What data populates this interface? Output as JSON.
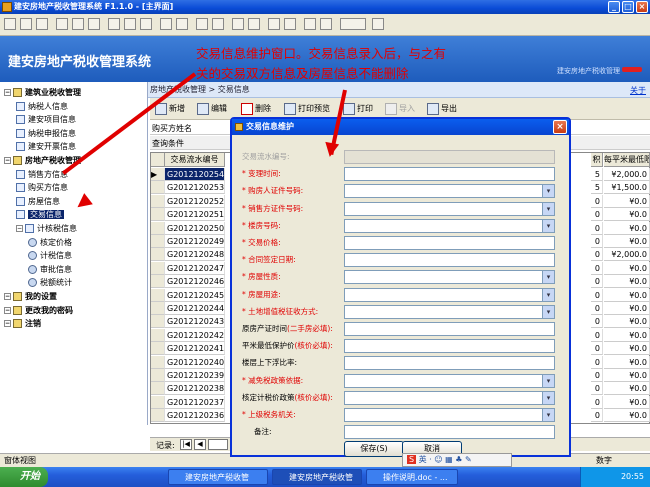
{
  "window": {
    "title": "建安房地产税收管理系统 F1.1.0 - [主界面]",
    "min": "_",
    "max": "□",
    "close": "×"
  },
  "banner": {
    "app_title": "建安房地产税收管理系统",
    "user_info": "建安房地产税收管理",
    "help_link": "关于"
  },
  "annotation": {
    "line1": "交易信息维护窗口。交易信息录入后，与之有",
    "line2": "关的交易双方信息及房屋信息不能删除"
  },
  "tree": {
    "items": [
      {
        "label": "建筑业税收管理",
        "bold": true,
        "level": 0
      },
      {
        "label": "纳税人信息",
        "level": 1
      },
      {
        "label": "建安项目信息",
        "level": 1
      },
      {
        "label": "纳税申报信息",
        "level": 1
      },
      {
        "label": "建安开票信息",
        "level": 1
      },
      {
        "label": "房地产税收管理",
        "bold": true,
        "level": 0
      },
      {
        "label": "销售方信息",
        "level": 1
      },
      {
        "label": "购买方信息",
        "level": 1
      },
      {
        "label": "房屋信息",
        "level": 1
      },
      {
        "label": "交易信息",
        "level": 1,
        "selected": true
      },
      {
        "label": "计核税信息",
        "level": 1
      },
      {
        "label": "核定价格",
        "level": 2
      },
      {
        "label": "计税信息",
        "level": 2
      },
      {
        "label": "审批信息",
        "level": 2
      },
      {
        "label": "税额统计",
        "level": 2
      },
      {
        "label": "我的设置",
        "bold": true,
        "level": 0
      },
      {
        "label": "更改我的密码",
        "bold": true,
        "level": 0
      },
      {
        "label": "注销",
        "bold": true,
        "level": 0
      }
    ]
  },
  "breadcrumb": "房地产税收管理 > 交易信息",
  "subtoolbar": {
    "new": "新增",
    "edit": "编辑",
    "delete": "删除",
    "print_preview": "打印预览",
    "print": "打印",
    "import": "导入",
    "export": "导出"
  },
  "filter": {
    "label": "购买方姓名",
    "label2": "查询条件"
  },
  "grid": {
    "headers": {
      "col1": "交易流水编号",
      "col2": "积",
      "col3": "每平米最低限价"
    },
    "rows": [
      {
        "id": "G2012120254",
        "a": "5",
        "b": "¥2,000.0"
      },
      {
        "id": "G2012120253",
        "a": "5",
        "b": "¥1,500.0"
      },
      {
        "id": "G2012120252",
        "a": "0",
        "b": "¥0.0"
      },
      {
        "id": "G2012120251",
        "a": "0",
        "b": "¥0.0"
      },
      {
        "id": "G2012120250",
        "a": "0",
        "b": "¥0.0"
      },
      {
        "id": "G2012120249",
        "a": "0",
        "b": "¥0.0"
      },
      {
        "id": "G2012120248",
        "a": "0",
        "b": "¥2,000.0"
      },
      {
        "id": "G2012120247",
        "a": "0",
        "b": "¥0.0"
      },
      {
        "id": "G2012120246",
        "a": "0",
        "b": "¥0.0"
      },
      {
        "id": "G2012120245",
        "a": "0",
        "b": "¥0.0"
      },
      {
        "id": "G2012120244",
        "a": "0",
        "b": "¥0.0"
      },
      {
        "id": "G2012120243",
        "a": "0",
        "b": "¥0.0"
      },
      {
        "id": "G2012120242",
        "a": "0",
        "b": "¥0.0"
      },
      {
        "id": "G2012120241",
        "a": "0",
        "b": "¥0.0"
      },
      {
        "id": "G2012120240",
        "a": "0",
        "b": "¥0.0"
      },
      {
        "id": "G2012120239",
        "a": "0",
        "b": "¥0.0"
      },
      {
        "id": "G2012120238",
        "a": "0",
        "b": "¥0.0"
      },
      {
        "id": "G2012120237",
        "a": "0",
        "b": "¥0.0"
      },
      {
        "id": "G2012120236",
        "a": "0",
        "b": "¥0.0"
      }
    ]
  },
  "recbar": {
    "label": "记录:"
  },
  "status": {
    "left": "窗体视图",
    "right": "数字"
  },
  "dialog": {
    "title": "交易信息维护",
    "fields": [
      {
        "label": "交易流水编号:",
        "type": "disabled"
      },
      {
        "label": "变理时间:",
        "req": true,
        "type": "text"
      },
      {
        "label": "购房人证件号码:",
        "req": true,
        "type": "select"
      },
      {
        "label": "销售方证件号码:",
        "req": true,
        "type": "select"
      },
      {
        "label": "楼房号码:",
        "req": true,
        "type": "select"
      },
      {
        "label": "交易价格:",
        "req": true,
        "type": "text"
      },
      {
        "label": "合同签定日期:",
        "req": true,
        "type": "text"
      },
      {
        "label": "房屋性质:",
        "req": true,
        "type": "select"
      },
      {
        "label": "房屋用途:",
        "req": true,
        "type": "select"
      },
      {
        "label": "土地增值税征收方式:",
        "req": true,
        "type": "select"
      },
      {
        "label": "原房产证时间",
        "note": "(二手房必填):",
        "type": "text"
      },
      {
        "label": "平米最低保护价",
        "note": "(核价必填):",
        "type": "text"
      },
      {
        "label": "楼层上下浮比率:",
        "type": "text"
      },
      {
        "label": "减免税政策依据:",
        "req": true,
        "type": "select"
      },
      {
        "label": "核定计税价政策",
        "note": "(核价必填):",
        "type": "select"
      },
      {
        "label": "上级税务机关:",
        "req": true,
        "type": "select"
      },
      {
        "label": "备注:",
        "type": "text",
        "indent": true
      }
    ],
    "save": "保存(S)",
    "cancel": "取消"
  },
  "taskbar": {
    "start": "开始",
    "tasks": [
      "建安房地产税收管",
      "建安房地产税收管",
      "操作说明.doc - ..."
    ],
    "time": "20:55"
  },
  "ime": {
    "label": "英"
  }
}
